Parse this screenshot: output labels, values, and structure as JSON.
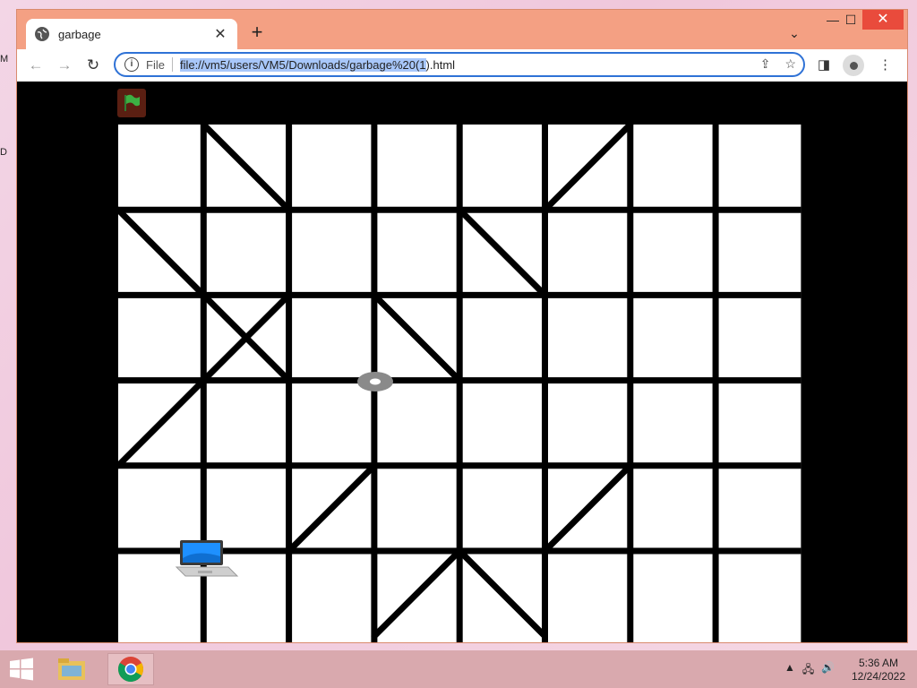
{
  "desktop": {
    "edge_label_1": "M",
    "edge_label_2": "D"
  },
  "browser": {
    "tab": {
      "title": "garbage",
      "close": "✕"
    },
    "new_tab": "+",
    "tab_search": "⌄",
    "window_controls": {
      "minimize": "—",
      "maximize": "☐",
      "close": "✕"
    },
    "nav": {
      "back": "←",
      "forward": "→",
      "reload": "↻"
    },
    "omnibox": {
      "info": "i",
      "scheme": "File",
      "url_selected": "file://vm5/users/VM5/Downloads/garbage%20(1",
      "url_rest": ").html",
      "share": "⇪",
      "bookmark": "☆"
    },
    "side_panel": "◨",
    "menu": "⋮"
  },
  "game": {
    "grid": {
      "cols": 8,
      "rows": 6
    },
    "diagonals": [
      [
        1,
        0,
        2,
        1
      ],
      [
        5,
        1,
        6,
        0
      ],
      [
        0,
        1,
        1,
        2
      ],
      [
        4,
        1,
        5,
        2
      ],
      [
        1,
        2,
        2,
        3
      ],
      [
        2,
        2,
        1,
        3
      ],
      [
        3,
        2,
        4,
        3
      ],
      [
        1,
        3,
        0,
        4
      ],
      [
        3,
        4,
        2,
        5
      ],
      [
        6,
        4,
        5,
        5
      ],
      [
        4,
        5,
        3,
        6
      ],
      [
        4,
        5,
        5,
        6
      ]
    ],
    "colors": {
      "background": "#000000",
      "cell": "#ffffff",
      "line": "#000000",
      "flag_bg": "#5a1f12",
      "flag": "#3cb043"
    }
  },
  "taskbar": {
    "tray": {
      "arrow": "▲",
      "network": "🖧",
      "volume": "🔊"
    },
    "clock": {
      "time": "5:36 AM",
      "date": "12/24/2022"
    }
  }
}
